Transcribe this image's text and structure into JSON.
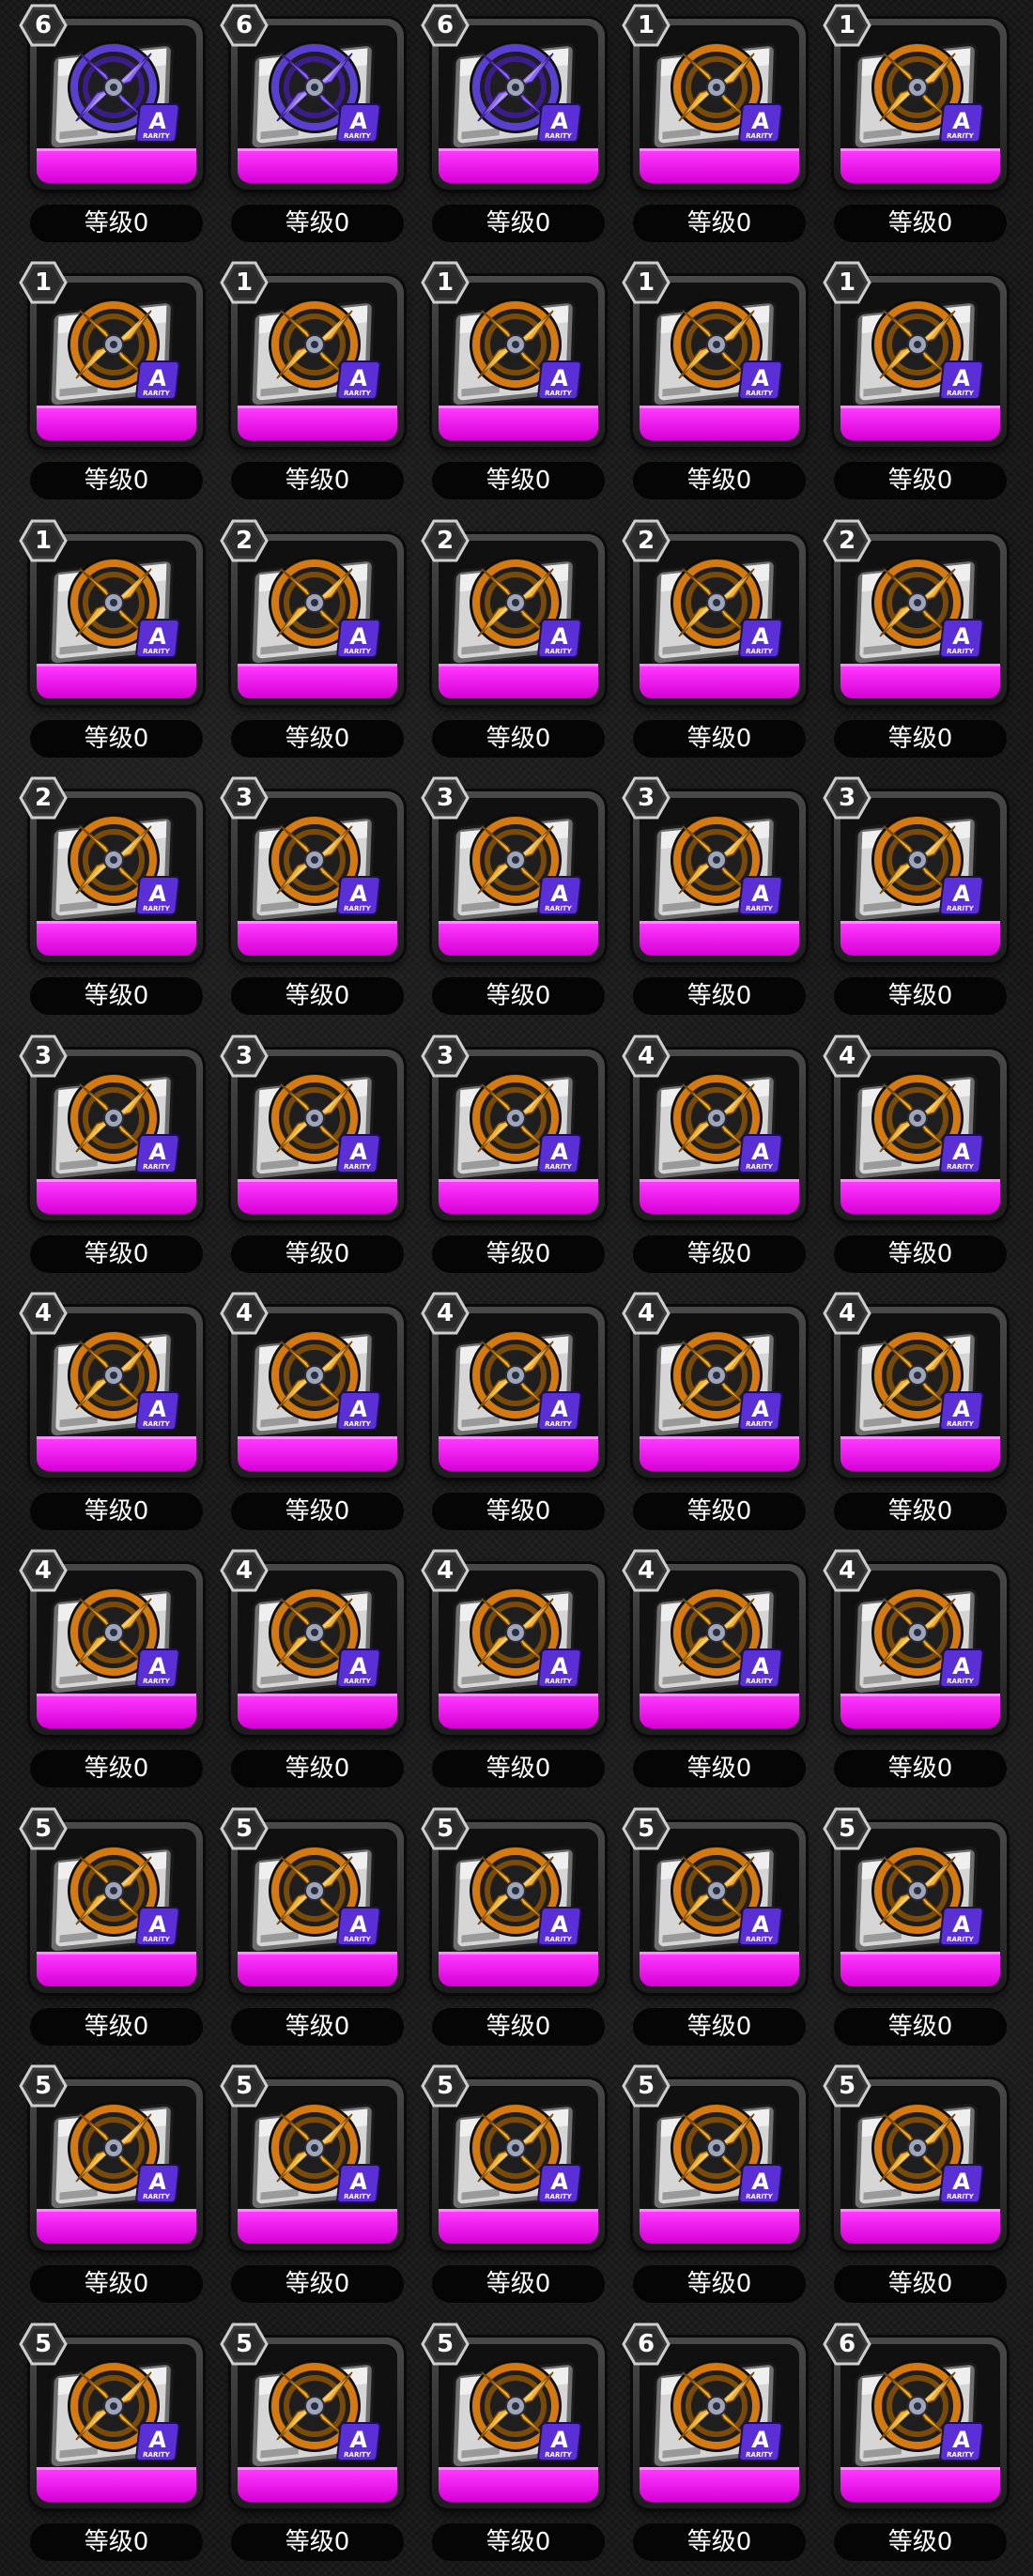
{
  "level_prefix": "等级",
  "colors": {
    "rarity": "#e61ee6",
    "level_bg": "#050505",
    "card_frame": "#3a3a3a",
    "gold": "#f0b030",
    "purple_disc": "#8c6cf0"
  },
  "chip_icon_label": "A",
  "chip_tag_text": "RARITY",
  "items": [
    {
      "tier": "6",
      "level": "0",
      "icon": "purple-disc-chip-icon"
    },
    {
      "tier": "6",
      "level": "0",
      "icon": "purple-disc-chip-icon"
    },
    {
      "tier": "6",
      "level": "0",
      "icon": "purple-disc-chip-icon"
    },
    {
      "tier": "1",
      "level": "0",
      "icon": "gold-disc-chip-icon"
    },
    {
      "tier": "1",
      "level": "0",
      "icon": "gold-disc-chip-icon"
    },
    {
      "tier": "1",
      "level": "0",
      "icon": "gold-disc-chip-icon"
    },
    {
      "tier": "1",
      "level": "0",
      "icon": "gold-disc-chip-icon"
    },
    {
      "tier": "1",
      "level": "0",
      "icon": "gold-disc-chip-icon"
    },
    {
      "tier": "1",
      "level": "0",
      "icon": "gold-disc-chip-icon"
    },
    {
      "tier": "1",
      "level": "0",
      "icon": "gold-disc-chip-icon"
    },
    {
      "tier": "1",
      "level": "0",
      "icon": "gold-disc-chip-icon"
    },
    {
      "tier": "2",
      "level": "0",
      "icon": "gold-disc-chip-icon"
    },
    {
      "tier": "2",
      "level": "0",
      "icon": "gold-disc-chip-icon"
    },
    {
      "tier": "2",
      "level": "0",
      "icon": "gold-disc-chip-icon"
    },
    {
      "tier": "2",
      "level": "0",
      "icon": "gold-disc-chip-icon"
    },
    {
      "tier": "2",
      "level": "0",
      "icon": "gold-disc-chip-icon"
    },
    {
      "tier": "3",
      "level": "0",
      "icon": "gold-disc-chip-icon"
    },
    {
      "tier": "3",
      "level": "0",
      "icon": "gold-disc-chip-icon"
    },
    {
      "tier": "3",
      "level": "0",
      "icon": "gold-disc-chip-icon"
    },
    {
      "tier": "3",
      "level": "0",
      "icon": "gold-disc-chip-icon"
    },
    {
      "tier": "3",
      "level": "0",
      "icon": "gold-disc-chip-icon"
    },
    {
      "tier": "3",
      "level": "0",
      "icon": "gold-disc-chip-icon"
    },
    {
      "tier": "3",
      "level": "0",
      "icon": "gold-disc-chip-icon"
    },
    {
      "tier": "4",
      "level": "0",
      "icon": "gold-disc-chip-icon"
    },
    {
      "tier": "4",
      "level": "0",
      "icon": "gold-disc-chip-icon"
    },
    {
      "tier": "4",
      "level": "0",
      "icon": "gold-disc-chip-icon"
    },
    {
      "tier": "4",
      "level": "0",
      "icon": "gold-disc-chip-icon"
    },
    {
      "tier": "4",
      "level": "0",
      "icon": "gold-disc-chip-icon"
    },
    {
      "tier": "4",
      "level": "0",
      "icon": "gold-disc-chip-icon"
    },
    {
      "tier": "4",
      "level": "0",
      "icon": "gold-disc-chip-icon"
    },
    {
      "tier": "4",
      "level": "0",
      "icon": "gold-disc-chip-icon"
    },
    {
      "tier": "4",
      "level": "0",
      "icon": "gold-disc-chip-icon"
    },
    {
      "tier": "4",
      "level": "0",
      "icon": "gold-disc-chip-icon"
    },
    {
      "tier": "4",
      "level": "0",
      "icon": "gold-disc-chip-icon"
    },
    {
      "tier": "4",
      "level": "0",
      "icon": "gold-disc-chip-icon"
    },
    {
      "tier": "5",
      "level": "0",
      "icon": "gold-disc-chip-icon"
    },
    {
      "tier": "5",
      "level": "0",
      "icon": "gold-disc-chip-icon"
    },
    {
      "tier": "5",
      "level": "0",
      "icon": "gold-disc-chip-icon"
    },
    {
      "tier": "5",
      "level": "0",
      "icon": "gold-disc-chip-icon"
    },
    {
      "tier": "5",
      "level": "0",
      "icon": "gold-disc-chip-icon"
    },
    {
      "tier": "5",
      "level": "0",
      "icon": "gold-disc-chip-icon"
    },
    {
      "tier": "5",
      "level": "0",
      "icon": "gold-disc-chip-icon"
    },
    {
      "tier": "5",
      "level": "0",
      "icon": "gold-disc-chip-icon"
    },
    {
      "tier": "5",
      "level": "0",
      "icon": "gold-disc-chip-icon"
    },
    {
      "tier": "5",
      "level": "0",
      "icon": "gold-disc-chip-icon"
    },
    {
      "tier": "5",
      "level": "0",
      "icon": "gold-disc-chip-icon"
    },
    {
      "tier": "5",
      "level": "0",
      "icon": "gold-disc-chip-icon"
    },
    {
      "tier": "5",
      "level": "0",
      "icon": "gold-disc-chip-icon"
    },
    {
      "tier": "6",
      "level": "0",
      "icon": "gold-disc-chip-icon"
    },
    {
      "tier": "6",
      "level": "0",
      "icon": "gold-disc-chip-icon"
    }
  ]
}
